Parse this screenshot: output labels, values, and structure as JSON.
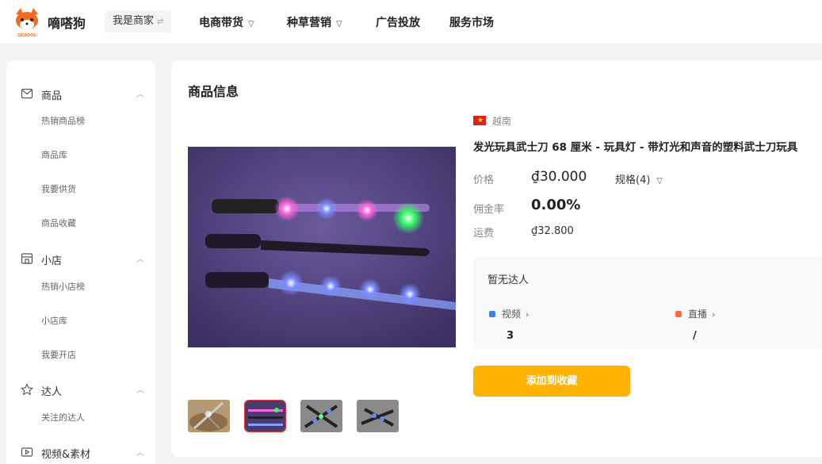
{
  "header": {
    "brand": "嘀嗒狗",
    "logo_text": "DIDADOG",
    "role": "我是商家",
    "nav": [
      "电商带货",
      "种草营销",
      "广告投放",
      "服务市场"
    ]
  },
  "sidebar": {
    "sections": [
      {
        "label": "商品",
        "icon": "mail-icon",
        "items": [
          "热销商品榜",
          "商品库",
          "我要供货",
          "商品收藏"
        ]
      },
      {
        "label": "小店",
        "icon": "store-icon",
        "items": [
          "热销小店榜",
          "小店库",
          "我要开店"
        ]
      },
      {
        "label": "达人",
        "icon": "star-icon",
        "items": [
          "关注的达人"
        ]
      },
      {
        "label": "视频&素材",
        "icon": "video-icon",
        "items": []
      }
    ]
  },
  "product": {
    "section_title": "商品信息",
    "country": "越南",
    "name": "发光玩具武士刀 68 厘米 - 玩具灯 - 带灯光和声音的塑料武士刀玩具",
    "price_label": "价格",
    "price": "₫30.000",
    "spec": "规格(4)",
    "commission_label": "佣金率",
    "commission": "0.00%",
    "shipping_label": "运费",
    "shipping": "₫32.800",
    "creators": {
      "empty_text": "暂无达人",
      "video_label": "视频",
      "video_value": "3",
      "live_label": "直播",
      "live_value": "/"
    },
    "fav_button": "添加到收藏"
  },
  "colors": {
    "accent": "#ffb300",
    "selected_thumb": "#ee3333",
    "video_badge": "#3b82f6",
    "live_badge": "#ff6b3d"
  }
}
